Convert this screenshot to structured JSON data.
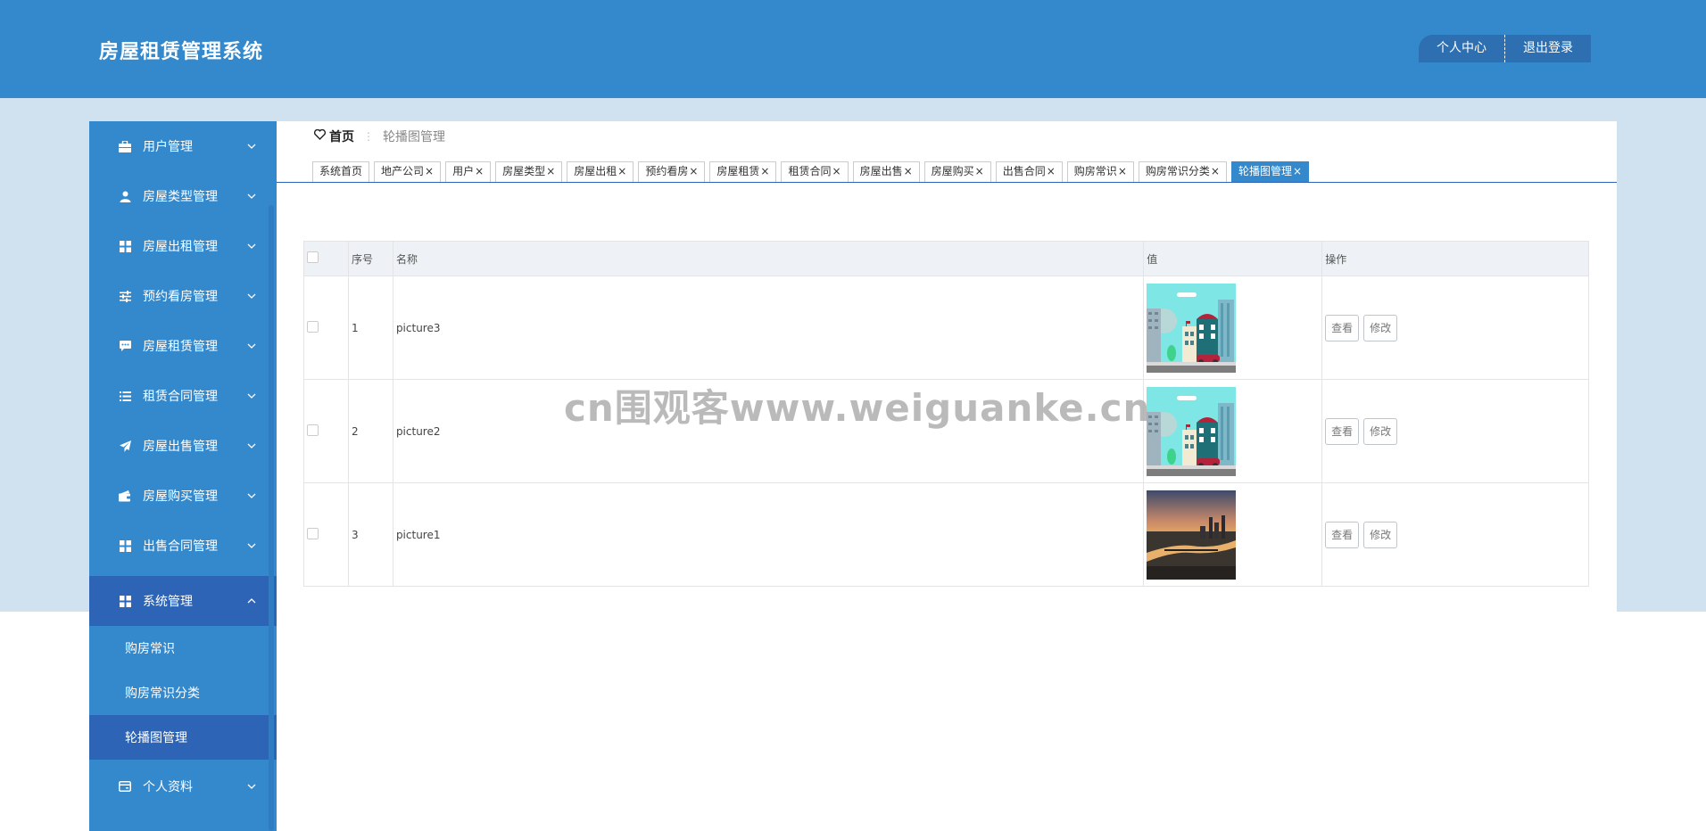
{
  "header": {
    "title": "房屋租赁管理系统",
    "profile_label": "个人中心",
    "logout_label": "退出登录"
  },
  "sidebar": {
    "items": [
      {
        "label": "用户管理",
        "icon": "briefcase-icon"
      },
      {
        "label": "房屋类型管理",
        "icon": "user-icon"
      },
      {
        "label": "房屋出租管理",
        "icon": "grid-icon"
      },
      {
        "label": "预约看房管理",
        "icon": "sliders-icon"
      },
      {
        "label": "房屋租赁管理",
        "icon": "chat-icon"
      },
      {
        "label": "租赁合同管理",
        "icon": "list-icon"
      },
      {
        "label": "房屋出售管理",
        "icon": "send-icon"
      },
      {
        "label": "房屋购买管理",
        "icon": "wallet-icon"
      },
      {
        "label": "出售合同管理",
        "icon": "grid-icon"
      },
      {
        "label": "系统管理",
        "icon": "grid-icon"
      }
    ],
    "sub_items": [
      {
        "label": "购房常识"
      },
      {
        "label": "购房常识分类"
      },
      {
        "label": "轮播图管理"
      }
    ],
    "profile_item": {
      "label": "个人资料",
      "icon": "card-icon"
    }
  },
  "breadcrumb": {
    "home": "首页",
    "separator": "⋮",
    "current": "轮播图管理"
  },
  "tabs": [
    {
      "label": "系统首页",
      "closable": false
    },
    {
      "label": "地产公司",
      "closable": true
    },
    {
      "label": "用户",
      "closable": true
    },
    {
      "label": "房屋类型",
      "closable": true
    },
    {
      "label": "房屋出租",
      "closable": true
    },
    {
      "label": "预约看房",
      "closable": true
    },
    {
      "label": "房屋租赁",
      "closable": true
    },
    {
      "label": "租赁合同",
      "closable": true
    },
    {
      "label": "房屋出售",
      "closable": true
    },
    {
      "label": "房屋购买",
      "closable": true
    },
    {
      "label": "出售合同",
      "closable": true
    },
    {
      "label": "购房常识",
      "closable": true
    },
    {
      "label": "购房常识分类",
      "closable": true
    },
    {
      "label": "轮播图管理",
      "closable": true,
      "active": true
    }
  ],
  "table": {
    "columns": {
      "index": "序号",
      "name": "名称",
      "value": "值",
      "actions": "操作"
    },
    "rows": [
      {
        "index": "1",
        "name": "picture3",
        "image": "city-illustration"
      },
      {
        "index": "2",
        "name": "picture2",
        "image": "city-illustration"
      },
      {
        "index": "3",
        "name": "picture1",
        "image": "city-sunset-photo"
      }
    ],
    "view_label": "查看",
    "edit_label": "修改"
  },
  "watermark": "cn围观客www.weiguanke.cn",
  "colors": {
    "primary": "#3488cc",
    "active": "#2d64b5",
    "band": "#d0e1f0"
  }
}
